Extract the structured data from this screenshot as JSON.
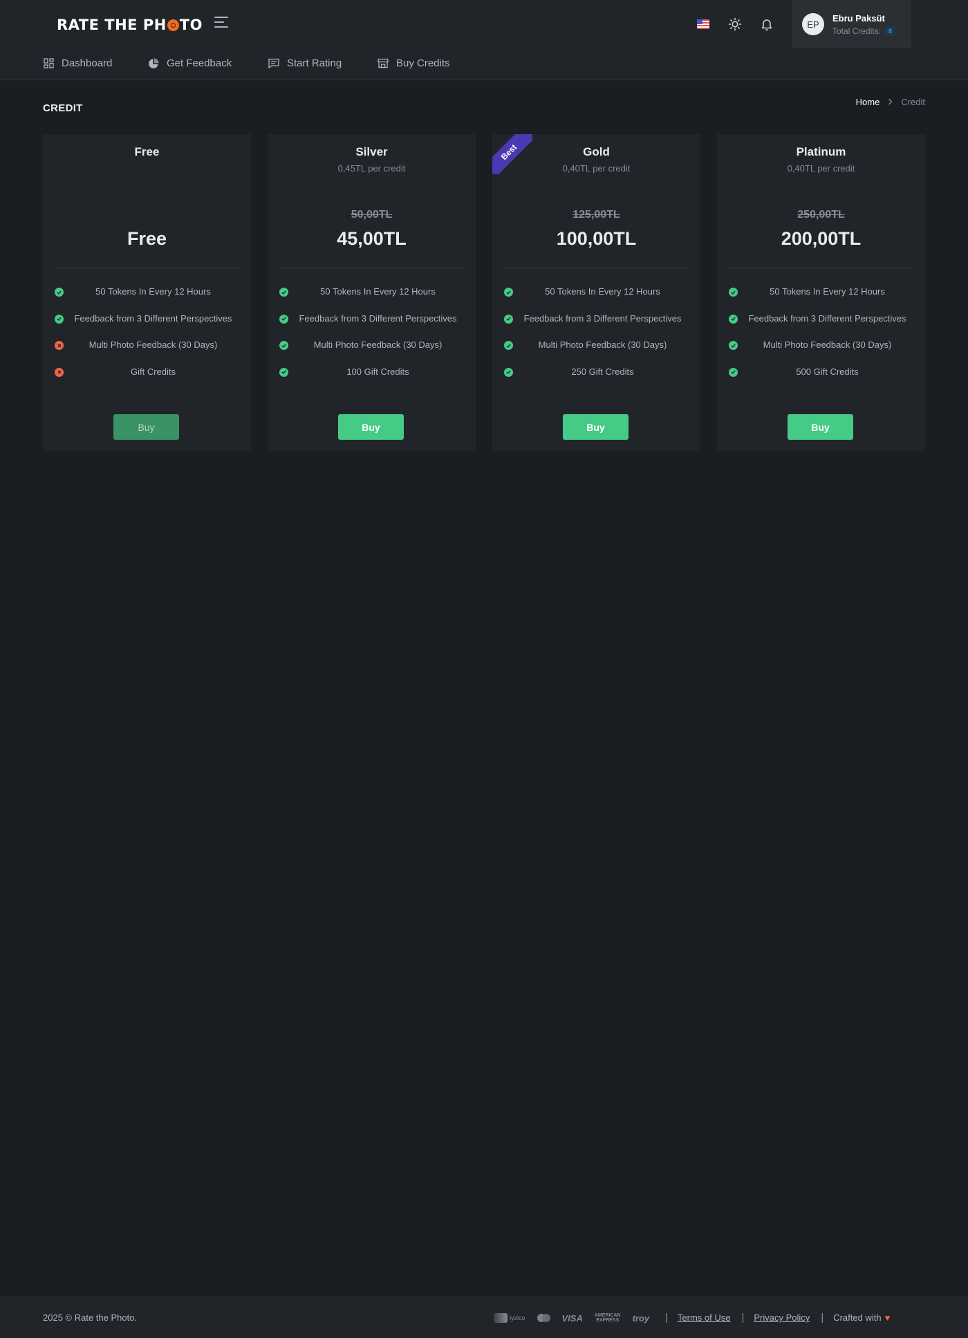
{
  "header": {
    "logo_part1": "RATE THE PH",
    "logo_part2": "TO",
    "user": {
      "initials": "EP",
      "name": "Ebru Paksüt",
      "credits_label": "Total Credits:",
      "credits_value": "8"
    }
  },
  "nav": {
    "items": [
      {
        "label": "Dashboard",
        "icon": "dashboard-icon"
      },
      {
        "label": "Get Feedback",
        "icon": "pie-chart-icon"
      },
      {
        "label": "Start Rating",
        "icon": "message-icon"
      },
      {
        "label": "Buy Credits",
        "icon": "store-icon"
      }
    ]
  },
  "page": {
    "title": "CREDIT",
    "breadcrumb": {
      "home": "Home",
      "current": "Credit"
    }
  },
  "plans": [
    {
      "name": "Free",
      "per_credit": "",
      "old_price": "",
      "price": "Free",
      "features": [
        {
          "text": "50 Tokens In Every 12 Hours",
          "status": "ok"
        },
        {
          "text": "Feedback from 3 Different Perspectives",
          "status": "ok"
        },
        {
          "text": "Multi Photo Feedback (30 Days)",
          "status": "no"
        },
        {
          "text": "Gift Credits",
          "status": "no"
        }
      ],
      "button": "Buy"
    },
    {
      "name": "Silver",
      "per_credit": "0,45TL per credit",
      "old_price": "50,00TL",
      "price": "45,00TL",
      "features": [
        {
          "text": "50 Tokens In Every 12 Hours",
          "status": "ok"
        },
        {
          "text": "Feedback from 3 Different Perspectives",
          "status": "ok"
        },
        {
          "text": "Multi Photo Feedback (30 Days)",
          "status": "ok"
        },
        {
          "text": "100 Gift Credits",
          "status": "ok"
        }
      ],
      "button": "Buy"
    },
    {
      "name": "Gold",
      "ribbon": "Best",
      "per_credit": "0,40TL per credit",
      "old_price": "125,00TL",
      "price": "100,00TL",
      "features": [
        {
          "text": "50 Tokens In Every 12 Hours",
          "status": "ok"
        },
        {
          "text": "Feedback from 3 Different Perspectives",
          "status": "ok"
        },
        {
          "text": "Multi Photo Feedback (30 Days)",
          "status": "ok"
        },
        {
          "text": "250 Gift Credits",
          "status": "ok"
        }
      ],
      "button": "Buy"
    },
    {
      "name": "Platinum",
      "per_credit": "0,40TL per credit",
      "old_price": "250,00TL",
      "price": "200,00TL",
      "features": [
        {
          "text": "50 Tokens In Every 12 Hours",
          "status": "ok"
        },
        {
          "text": "Feedback from 3 Different Perspectives",
          "status": "ok"
        },
        {
          "text": "Multi Photo Feedback (30 Days)",
          "status": "ok"
        },
        {
          "text": "500 Gift Credits",
          "status": "ok"
        }
      ],
      "button": "Buy"
    }
  ],
  "footer": {
    "copyright": "2025 © Rate the Photo.",
    "payments": {
      "iyzico": "iyzico",
      "visa": "VISA",
      "amex_line1": "AMERICAN",
      "amex_line2": "EXPRESS",
      "troy": "troy"
    },
    "terms": "Terms of Use",
    "privacy": "Privacy Policy",
    "crafted": "Crafted with"
  },
  "colors": {
    "accent_green": "#45cb85",
    "error_red": "#f06548",
    "ribbon_purple": "#4b38b3",
    "logo_orange": "#f06b1f"
  }
}
